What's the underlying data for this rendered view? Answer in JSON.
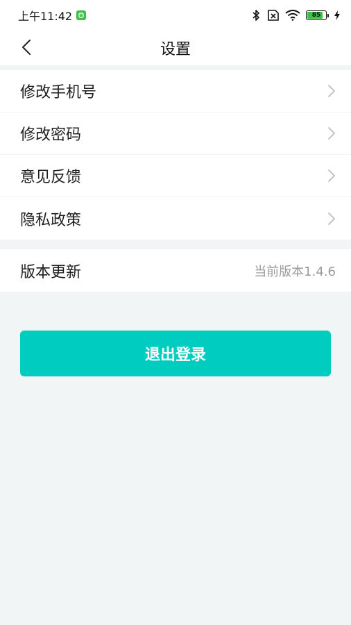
{
  "status_bar": {
    "time": "上午11:42",
    "battery_level": "85",
    "battery_fill_percent": 85,
    "icons": [
      "bluetooth-icon",
      "sim-x-icon",
      "wifi-icon",
      "battery-icon",
      "charging-icon"
    ]
  },
  "header": {
    "title": "设置",
    "back_icon": "chevron-left-icon"
  },
  "settings": {
    "items": [
      {
        "label": "修改手机号"
      },
      {
        "label": "修改密码"
      },
      {
        "label": "意见反馈"
      },
      {
        "label": "隐私政策"
      }
    ],
    "version": {
      "label": "版本更新",
      "value": "当前版本1.4.6"
    }
  },
  "logout": {
    "label": "退出登录"
  },
  "colors": {
    "accent": "#00cdbf",
    "background": "#f1f5f6",
    "battery": "#3fbf4a"
  }
}
